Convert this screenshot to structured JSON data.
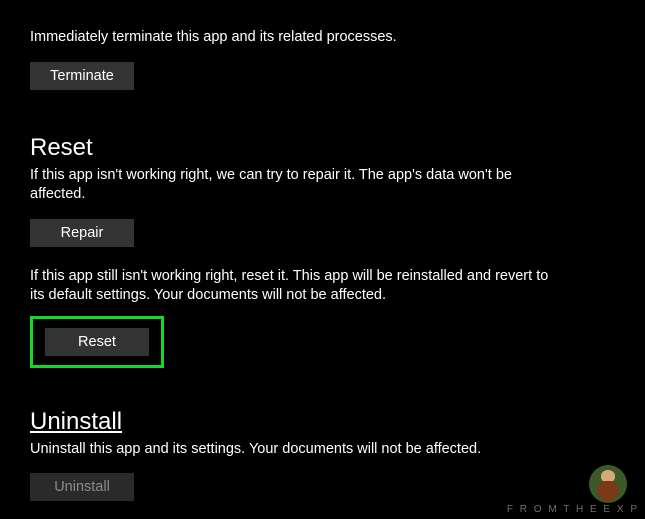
{
  "terminate": {
    "description": "Immediately terminate this app and its related processes.",
    "button_label": "Terminate"
  },
  "reset": {
    "heading": "Reset",
    "repair_description": "If this app isn't working right, we can try to repair it. The app's data won't be affected.",
    "repair_button_label": "Repair",
    "reset_description": "If this app still isn't working right, reset it. This app will be reinstalled and revert to its default settings. Your documents will not be affected.",
    "reset_button_label": "Reset"
  },
  "uninstall": {
    "heading": "Uninstall",
    "description": "Uninstall this app and its settings. Your documents will not be affected.",
    "button_label": "Uninstall"
  },
  "watermark": "F R O M   T H E   E X P"
}
